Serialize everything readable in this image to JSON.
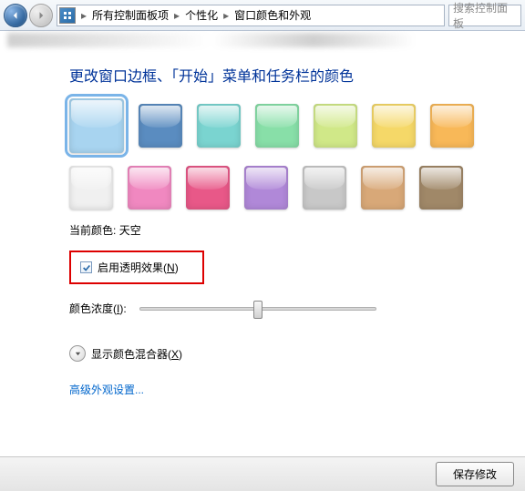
{
  "nav": {
    "breadcrumb": [
      "所有控制面板项",
      "个性化",
      "窗口颜色和外观"
    ],
    "search_placeholder": "搜索控制面板"
  },
  "page_title": "更改窗口边框、「开始」菜单和任务栏的颜色",
  "color_rows": [
    [
      "#a8d4f0",
      "#5a8cc0",
      "#7ad4d0",
      "#88dfa8",
      "#d0e888",
      "#f5d868",
      "#f8b858"
    ],
    [
      "#f0f0f0",
      "#f088c0",
      "#e85888",
      "#b088d8",
      "#c8c8c8",
      "#d8a878",
      "#a08868"
    ]
  ],
  "selected_color_index": 0,
  "current_color_label": "当前颜色:",
  "current_color_value": "天空",
  "transparency": {
    "label": "启用透明效果",
    "hotkey": "N",
    "checked": true
  },
  "intensity": {
    "label": "颜色浓度",
    "hotkey": "I",
    "value": 48
  },
  "mixer": {
    "label": "显示颜色混合器",
    "hotkey": "X"
  },
  "advanced_link": "高级外观设置...",
  "footer": {
    "save_label": "保存修改"
  }
}
